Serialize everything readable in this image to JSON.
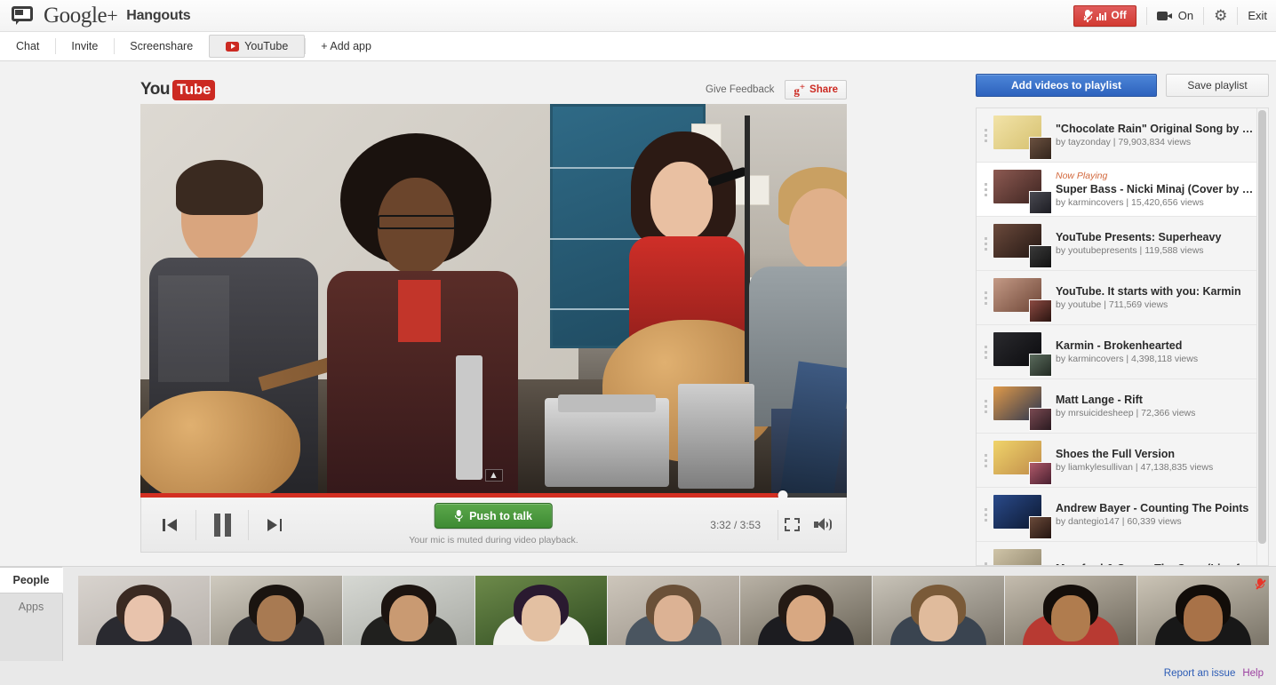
{
  "app": {
    "brand_google": "Google",
    "brand_plus": "+",
    "product": "Hangouts"
  },
  "topbar": {
    "mic_icon": "mic-off-icon",
    "mic_label": "Off",
    "camera_icon": "video-camera-icon",
    "camera_label": "On",
    "settings_icon": "gear-icon",
    "exit_label": "Exit"
  },
  "apptabs": [
    {
      "label": "Chat",
      "active": false,
      "icon": null
    },
    {
      "label": "Invite",
      "active": false,
      "icon": null
    },
    {
      "label": "Screenshare",
      "active": false,
      "icon": null
    },
    {
      "label": "YouTube",
      "active": true,
      "icon": "youtube-icon"
    },
    {
      "label": "+ Add app",
      "active": false,
      "icon": null
    }
  ],
  "player": {
    "logo_you": "You",
    "logo_tube": "Tube",
    "give_feedback": "Give Feedback",
    "share_icon": "google-plus-share-icon",
    "share_label": "Share",
    "prev_icon": "previous-track-icon",
    "pause_icon": "pause-icon",
    "next_icon": "next-track-icon",
    "push_to_talk_icon": "microphone-icon",
    "push_to_talk_label": "Push to talk",
    "mic_note": "Your mic is muted during video playback.",
    "time_current": "3:32",
    "time_total": "3:53",
    "time_display": "3:32 / 3:53",
    "progress_percent": 91,
    "fullscreen_icon": "fullscreen-icon",
    "volume_icon": "volume-on-icon",
    "expand_icon": "chevron-up-icon"
  },
  "playlist": {
    "add_button": "Add videos to playlist",
    "save_button": "Save playlist",
    "now_playing_label": "Now Playing",
    "items": [
      {
        "title": "\"Chocolate Rain\" Original Song by T…",
        "meta": "by tayzonday | 79,903,834 views",
        "now_playing": false,
        "thumb_from": "#f2e3a8",
        "thumb_to": "#d6c170",
        "avatar_from": "#6b5140",
        "avatar_to": "#33251c"
      },
      {
        "title": "Super Bass - Nicki Minaj (Cover by @…",
        "meta": "by karmincovers | 15,420,656 views",
        "now_playing": true,
        "thumb_from": "#8d5a52",
        "thumb_to": "#3d2420",
        "avatar_from": "#4a4a52",
        "avatar_to": "#1c1c22"
      },
      {
        "title": "YouTube Presents: Superheavy",
        "meta": "by youtubepresents | 119,588 views",
        "now_playing": false,
        "thumb_from": "#6b4a3c",
        "thumb_to": "#241713",
        "avatar_from": "#3a3a3a",
        "avatar_to": "#121212"
      },
      {
        "title": "YouTube. It starts with you: Karmin",
        "meta": "by youtube | 711,569 views",
        "now_playing": false,
        "thumb_from": "#c49a86",
        "thumb_to": "#6d4536",
        "avatar_from": "#8c4a42",
        "avatar_to": "#2a1410"
      },
      {
        "title": "Karmin - Brokenhearted",
        "meta": "by karmincovers | 4,398,118 views",
        "now_playing": false,
        "thumb_from": "#2a2a2e",
        "thumb_to": "#0b0b0e",
        "avatar_from": "#5a6b5c",
        "avatar_to": "#222a23"
      },
      {
        "title": "Matt Lange - Rift",
        "meta": "by mrsuicidesheep | 72,366 views",
        "now_playing": false,
        "thumb_from": "#e09a4a",
        "thumb_to": "#2b3550",
        "avatar_from": "#7a4a52",
        "avatar_to": "#2a1a20"
      },
      {
        "title": "Shoes the Full Version",
        "meta": "by liamkylesullivan | 47,138,835 views",
        "now_playing": false,
        "thumb_from": "#f0d46a",
        "thumb_to": "#c08c4a",
        "avatar_from": "#b05a6a",
        "avatar_to": "#4a2030"
      },
      {
        "title": "Andrew Bayer - Counting The Points",
        "meta": "by dantegio147 | 60,339 views",
        "now_playing": false,
        "thumb_from": "#2a4a8a",
        "thumb_to": "#0c1830",
        "avatar_from": "#6a4a3a",
        "avatar_to": "#241410"
      },
      {
        "title": "Mumford & Sons - The Cave (Live fro",
        "meta": "",
        "now_playing": false,
        "thumb_from": "#cfc4a8",
        "thumb_to": "#8a7f66",
        "avatar_from": "#5a5a5a",
        "avatar_to": "#202020"
      }
    ]
  },
  "bottom": {
    "tabs": [
      {
        "label": "People",
        "active": true
      },
      {
        "label": "Apps",
        "active": false
      }
    ],
    "participants": [
      {
        "bg_from": "#d8d3ce",
        "bg_to": "#b7b1ab",
        "skin": "#e8c3ac",
        "hair": "#3a2a22",
        "shirt": "#2a2a30",
        "muted": false
      },
      {
        "bg_from": "#cfcabf",
        "bg_to": "#8a8478",
        "skin": "#a87a52",
        "hair": "#1a1410",
        "shirt": "#2a2a2e",
        "muted": false
      },
      {
        "bg_from": "#d6d8d3",
        "bg_to": "#a8aaa4",
        "skin": "#c99a72",
        "hair": "#1c1410",
        "shirt": "#20201e",
        "muted": false
      },
      {
        "bg_from": "#6d8a4a",
        "bg_to": "#2e4a20",
        "skin": "#e3c0a2",
        "hair": "#2a1a30",
        "shirt": "#f2f2f0",
        "muted": false
      },
      {
        "bg_from": "#cdc6bb",
        "bg_to": "#9a9288",
        "skin": "#dcb294",
        "hair": "#6a5038",
        "shirt": "#4a5560",
        "muted": false
      },
      {
        "bg_from": "#b9b2a6",
        "bg_to": "#6b6558",
        "skin": "#d8a882",
        "hair": "#241a14",
        "shirt": "#1c1c20",
        "muted": false
      },
      {
        "bg_from": "#c8c3b8",
        "bg_to": "#7a746a",
        "skin": "#e0bb9c",
        "hair": "#7a5a38",
        "shirt": "#3a4450",
        "muted": false
      },
      {
        "bg_from": "#c4bcae",
        "bg_to": "#6e685c",
        "skin": "#b07c4e",
        "hair": "#140e0a",
        "shirt": "#b83a32",
        "muted": false
      },
      {
        "bg_from": "#cbc4b6",
        "bg_to": "#7a7468",
        "skin": "#a87248",
        "hair": "#120d09",
        "shirt": "#181818",
        "muted": true
      }
    ],
    "report_link": "Report an issue",
    "help_link": "Help"
  }
}
